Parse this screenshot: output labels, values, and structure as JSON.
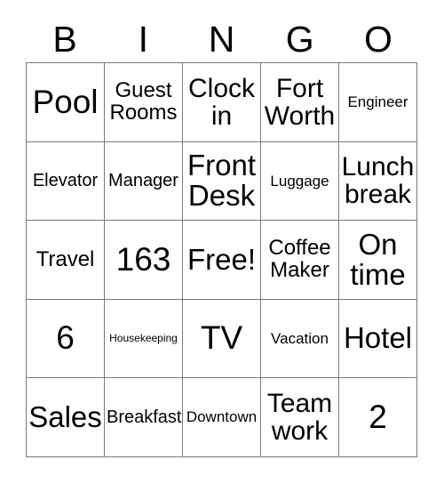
{
  "card": {
    "title": "BINGO",
    "header_letters": [
      "B",
      "I",
      "N",
      "G",
      "O"
    ],
    "grid_rows": 5,
    "grid_cols": 5,
    "border_color": "#7a7a7a",
    "text_color": "#000000",
    "background_color": "#ffffff",
    "cells": [
      {
        "text": "Pool",
        "size": "xxl",
        "column": "B",
        "row": 1,
        "marked": false
      },
      {
        "text": "Guest\nRooms",
        "size": "md",
        "column": "I",
        "row": 1,
        "marked": false
      },
      {
        "text": "Clock\nin",
        "size": "lg",
        "column": "N",
        "row": 1,
        "marked": false
      },
      {
        "text": "Fort\nWorth",
        "size": "lg",
        "column": "G",
        "row": 1,
        "marked": false
      },
      {
        "text": "Engineer",
        "size": "xs",
        "column": "O",
        "row": 1,
        "marked": false
      },
      {
        "text": "Elevator",
        "size": "sm",
        "column": "B",
        "row": 2,
        "marked": false
      },
      {
        "text": "Manager",
        "size": "sm",
        "column": "I",
        "row": 2,
        "marked": false
      },
      {
        "text": "Front\nDesk",
        "size": "xl",
        "column": "N",
        "row": 2,
        "marked": false
      },
      {
        "text": "Luggage",
        "size": "xs",
        "column": "G",
        "row": 2,
        "marked": false
      },
      {
        "text": "Lunch\nbreak",
        "size": "lg",
        "column": "O",
        "row": 2,
        "marked": false
      },
      {
        "text": "Travel",
        "size": "md",
        "column": "B",
        "row": 3,
        "marked": false
      },
      {
        "text": "163",
        "size": "xxl",
        "column": "I",
        "row": 3,
        "marked": false
      },
      {
        "text": "Free!",
        "size": "xl",
        "column": "N",
        "row": 3,
        "marked": false
      },
      {
        "text": "Coffee\nMaker",
        "size": "md",
        "column": "G",
        "row": 3,
        "marked": false
      },
      {
        "text": "On\ntime",
        "size": "xl",
        "column": "O",
        "row": 3,
        "marked": false
      },
      {
        "text": "6",
        "size": "xxl",
        "column": "B",
        "row": 4,
        "marked": false
      },
      {
        "text": "Housekeeping",
        "size": "xxs",
        "column": "I",
        "row": 4,
        "marked": false
      },
      {
        "text": "TV",
        "size": "xxl",
        "column": "N",
        "row": 4,
        "marked": false
      },
      {
        "text": "Vacation",
        "size": "xs",
        "column": "G",
        "row": 4,
        "marked": false
      },
      {
        "text": "Hotel",
        "size": "xl",
        "column": "O",
        "row": 4,
        "marked": false
      },
      {
        "text": "Sales",
        "size": "xl",
        "column": "B",
        "row": 5,
        "marked": false
      },
      {
        "text": "Breakfast",
        "size": "sm",
        "column": "I",
        "row": 5,
        "marked": false
      },
      {
        "text": "Downtown",
        "size": "xs",
        "column": "N",
        "row": 5,
        "marked": false
      },
      {
        "text": "Team\nwork",
        "size": "lg",
        "column": "G",
        "row": 5,
        "marked": false
      },
      {
        "text": "2",
        "size": "xxl",
        "column": "O",
        "row": 5,
        "marked": false
      }
    ]
  }
}
